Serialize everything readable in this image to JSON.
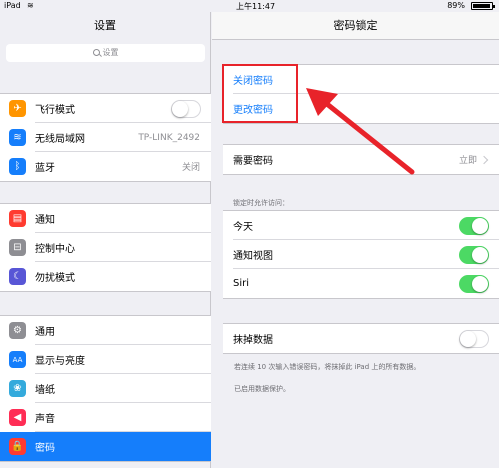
{
  "statusbar": {
    "device": "iPad",
    "time": "上午11:47",
    "battery": "89%"
  },
  "left": {
    "title": "设置",
    "search_placeholder": "设置",
    "groups": [
      [
        {
          "label": "飞行模式",
          "icon": "airplane-icon",
          "color": "#ff9500",
          "glyph": "✈",
          "toggle": false
        },
        {
          "label": "无线局域网",
          "icon": "wifi-icon",
          "color": "#157efb",
          "glyph": "≋",
          "value": "TP-LINK_2492"
        },
        {
          "label": "蓝牙",
          "icon": "bluetooth-icon",
          "color": "#157efb",
          "glyph": "ᛒ",
          "value": "关闭"
        }
      ],
      [
        {
          "label": "通知",
          "icon": "notifications-icon",
          "color": "#ff3b30",
          "glyph": "▤"
        },
        {
          "label": "控制中心",
          "icon": "control-center-icon",
          "color": "#8e8e93",
          "glyph": "⊟"
        },
        {
          "label": "勿扰模式",
          "icon": "moon-icon",
          "color": "#5856d6",
          "glyph": "☾"
        }
      ],
      [
        {
          "label": "通用",
          "icon": "gear-icon",
          "color": "#8e8e93",
          "glyph": "⚙"
        },
        {
          "label": "显示与亮度",
          "icon": "display-icon",
          "color": "#157efb",
          "glyph": "AA"
        },
        {
          "label": "墙纸",
          "icon": "wallpaper-icon",
          "color": "#34aadc",
          "glyph": "❀"
        },
        {
          "label": "声音",
          "icon": "sound-icon",
          "color": "#ff2d55",
          "glyph": "◀"
        },
        {
          "label": "密码",
          "icon": "lock-icon",
          "color": "#ff3b30",
          "glyph": "🔒",
          "selected": true
        }
      ]
    ]
  },
  "right": {
    "title": "密码锁定",
    "turn_off": "关闭密码",
    "change": "更改密码",
    "require_label": "需要密码",
    "require_value": "立即",
    "allow_header": "锁定时允许访问：",
    "allow": [
      {
        "label": "今天",
        "on": true
      },
      {
        "label": "通知视图",
        "on": true
      },
      {
        "label": "Siri",
        "on": true
      }
    ],
    "erase_label": "抹掉数据",
    "erase_on": false,
    "erase_note": "若连续 10 次输入错误密码，将抹掉此 iPad 上的所有数据。",
    "protect_note": "已启用数据保护。"
  },
  "colors": {
    "accent": "#157efb",
    "highlight": "#e8232a",
    "toggle_on": "#4cd964"
  }
}
